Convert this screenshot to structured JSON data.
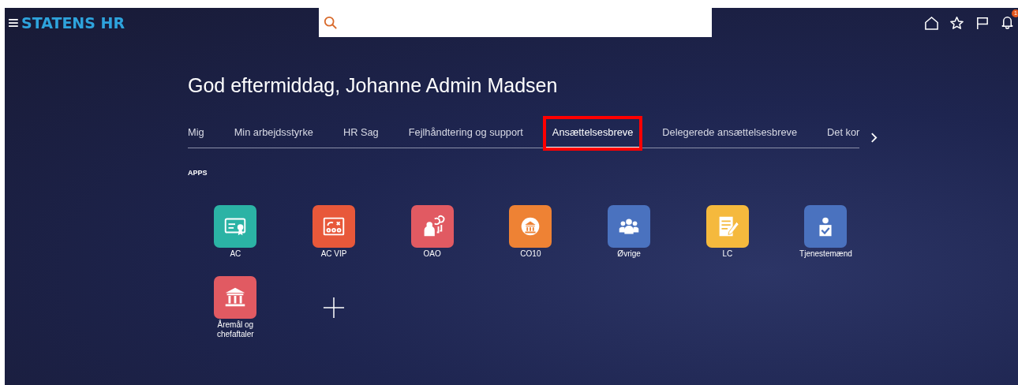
{
  "header": {
    "menu_icon": "≡",
    "brand": "STATENS HR",
    "notification_count": "1"
  },
  "greeting": "God eftermiddag, Johanne Admin Madsen",
  "tabs": [
    {
      "label": "Mig",
      "selected": false,
      "highlighted": false
    },
    {
      "label": "Min arbejdsstyrke",
      "selected": false,
      "highlighted": false
    },
    {
      "label": "HR Sag",
      "selected": false,
      "highlighted": false
    },
    {
      "label": "Fejlhåndtering og support",
      "selected": false,
      "highlighted": false
    },
    {
      "label": "Ansættelsesbreve",
      "selected": true,
      "highlighted": true
    },
    {
      "label": "Delegerede ansættelsesbreve",
      "selected": false,
      "highlighted": false
    },
    {
      "label": "Det kor",
      "selected": false,
      "highlighted": false
    }
  ],
  "section_title": "APPS",
  "apps": [
    {
      "label": "AC",
      "kind": "certificate",
      "color": "#2bb3a5"
    },
    {
      "label": "AC VIP",
      "kind": "board",
      "color": "#e8583a"
    },
    {
      "label": "OAO",
      "kind": "speaker",
      "color": "#e15a62"
    },
    {
      "label": "CO10",
      "kind": "bank-circle",
      "color": "#ee8234"
    },
    {
      "label": "Øvrige",
      "kind": "group",
      "color": "#4a72bf"
    },
    {
      "label": "LC",
      "kind": "note",
      "color": "#f5b93d"
    },
    {
      "label": "Tjenestemænd",
      "kind": "badge",
      "color": "#4a72bf"
    },
    {
      "label": "Åremål og chefaftaler",
      "kind": "bank",
      "color": "#e15a62"
    }
  ]
}
